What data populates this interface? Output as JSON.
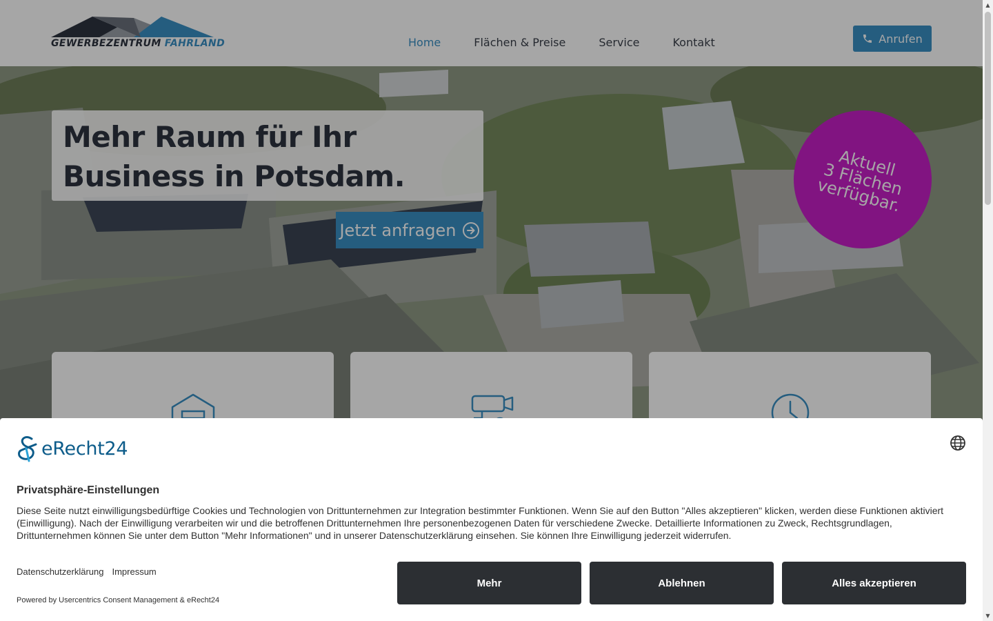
{
  "header": {
    "brand_word1": "GEWERBEZENTRUM",
    "brand_word2": "FAHRLAND",
    "nav": [
      {
        "label": "Home",
        "active": true
      },
      {
        "label": "Flächen & Preise"
      },
      {
        "label": "Service"
      },
      {
        "label": "Kontakt"
      }
    ],
    "call_label": "Anrufen"
  },
  "hero": {
    "headline_line1": "Mehr Raum für Ihr",
    "headline_line2": "Business in Potsdam.",
    "cta_label": "Jetzt anfragen",
    "badge_line1": "Aktuell",
    "badge_line2": "3 Flächen",
    "badge_line3": "verfügbar."
  },
  "feature_cards": [
    {
      "icon": "warehouse-icon"
    },
    {
      "icon": "security-camera-icon"
    },
    {
      "icon": "clock-icon"
    }
  ],
  "consent": {
    "logo_text": "eRecht24",
    "title": "Privatsphäre-Einstellungen",
    "body": "Diese Seite nutzt einwilligungsbedürftige Cookies und Technologien von Drittunternehmen zur Integration bestimmter Funktionen. Wenn Sie auf den Button \"Alles akzeptieren\" klicken, werden diese Funktionen aktiviert (Einwilligung). Nach der Einwilligung verarbeiten wir und die betroffenen Drittunternehmen Ihre personenbezogenen Daten für verschiedene Zwecke. Detaillierte Informationen zu Zweck, Rechtsgrundlagen, Drittunternehmen können Sie unter dem Button \"Mehr Informationen\" und in unserer Datenschutzerklärung einsehen. Sie können Ihre Einwilligung jederzeit widerrufen.",
    "link_privacy": "Datenschutzerklärung",
    "link_imprint": "Impressum",
    "powered_by": "Powered by Usercentrics Consent Management & eRecht24",
    "btn_more": "Mehr",
    "btn_decline": "Ablehnen",
    "btn_accept": "Alles akzeptieren"
  },
  "colors": {
    "accent_blue": "#3a8fc4",
    "brand_dark": "#2d3340",
    "badge_magenta": "#c61fc7",
    "consent_button": "#2c2f33",
    "erecht_teal": "#0d5c8a"
  }
}
